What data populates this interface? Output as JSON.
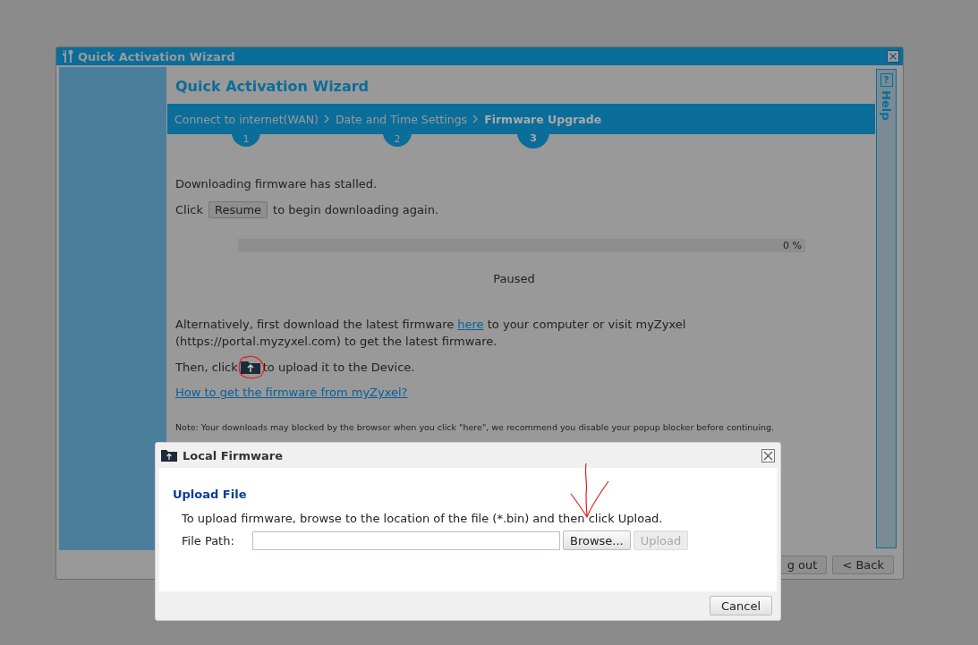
{
  "window": {
    "title": "Quick Activation Wizard"
  },
  "wizard": {
    "heading": "Quick Activation Wizard",
    "steps": [
      {
        "label": "Connect to internet(WAN)",
        "number": "1",
        "selected": false
      },
      {
        "label": "Date and Time Settings",
        "number": "2",
        "selected": false
      },
      {
        "label": "Firmware Upgrade",
        "number": "3",
        "selected": true
      }
    ]
  },
  "help": {
    "icon": "?",
    "label": "Help"
  },
  "content": {
    "status_message": "Downloading firmware has stalled.",
    "resume_prefix": "Click",
    "resume_button": "Resume",
    "resume_suffix": "to begin downloading again.",
    "progress": {
      "level": 0,
      "reading": "0 %",
      "status": "Paused"
    },
    "alternative_before": "Alternatively, first download the latest firmware",
    "alternative_link": "here",
    "alternative_after": "to your computer or visit myZyxel (https://portal.myzyxel.com) to get the latest firmware.",
    "upload_prefix": "Then, click",
    "upload_suffix": "to upload it to the Device.",
    "help_link": "How to get the firmware from myZyxel?",
    "note": "Note: Your downloads may blocked by the browser when you click \"here\", we recommend you disable your popup blocker before continuing."
  },
  "footer": {
    "buttons": [
      {
        "label": "g out"
      },
      {
        "label": "< Back"
      }
    ]
  },
  "dialog": {
    "title": "Local Firmware",
    "section_title": "Upload File",
    "instructions": "To upload firmware, browse to the location of the file (*.bin) and then click Upload.",
    "file_path_label": "File Path:",
    "browse_button": "Browse...",
    "upload_button": {
      "label": "Upload",
      "disabled": true
    },
    "cancel_button": "Cancel"
  }
}
